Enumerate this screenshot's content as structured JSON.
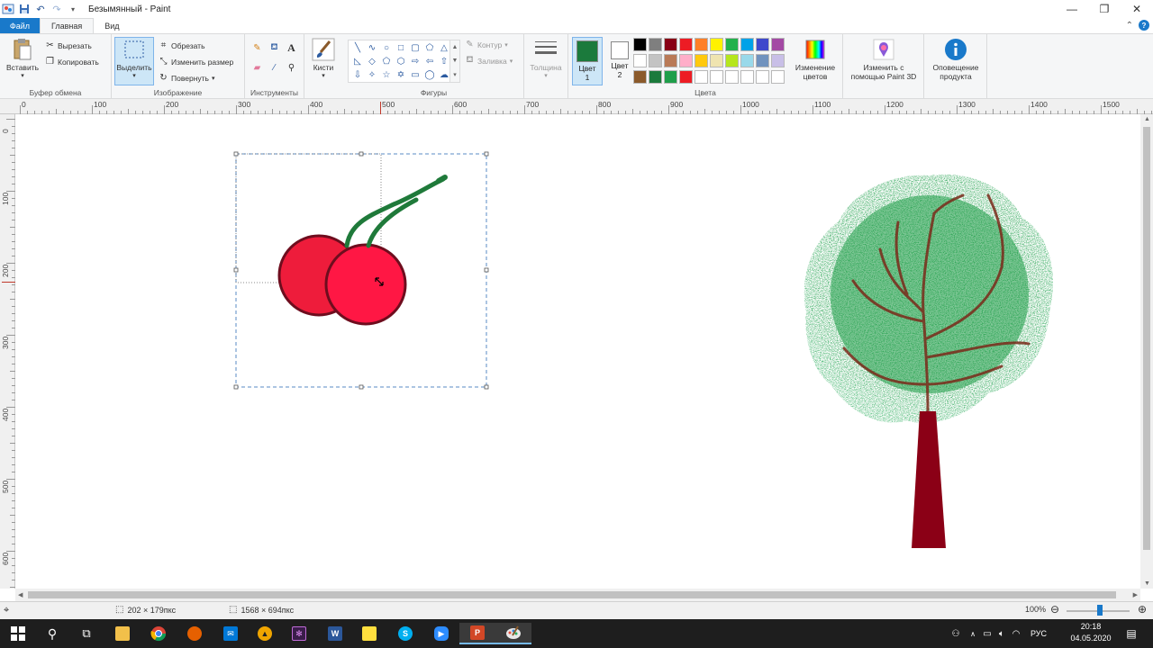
{
  "window": {
    "title": "Безымянный - Paint"
  },
  "tabs": [
    {
      "label": "Файл"
    },
    {
      "label": "Главная"
    },
    {
      "label": "Вид"
    }
  ],
  "ribbon": {
    "clipboard": {
      "group_label": "Буфер обмена",
      "paste": "Вставить",
      "cut": "Вырезать",
      "copy": "Копировать"
    },
    "image": {
      "group_label": "Изображение",
      "select": "Выделить",
      "crop": "Обрезать",
      "resize": "Изменить размер",
      "rotate": "Повернуть"
    },
    "tools": {
      "group_label": "Инструменты"
    },
    "brushes": {
      "label": "Кисти"
    },
    "shapes": {
      "group_label": "Фигуры",
      "outline": "Контур",
      "fill": "Заливка"
    },
    "size": {
      "label": "Толщина"
    },
    "colors": {
      "group_label": "Цвета",
      "color1_label": "Цвет\n1",
      "color1_a": "Цвет",
      "color1_b": "1",
      "color2_a": "Цвет",
      "color2_b": "2",
      "color1": "#1b7a3c",
      "color2": "#ffffff",
      "edit_colors_a": "Изменение",
      "edit_colors_b": "цветов",
      "palette": [
        "#000000",
        "#7f7f7f",
        "#880015",
        "#ed1c24",
        "#ff7f27",
        "#fff200",
        "#22b14c",
        "#00a2e8",
        "#3f48cc",
        "#a349a4",
        "#ffffff",
        "#c3c3c3",
        "#b97a57",
        "#ffaec9",
        "#ffc90e",
        "#efe4b0",
        "#b5e61d",
        "#99d9ea",
        "#7092be",
        "#c8bfe7",
        "#8b5a2b",
        "#1b7a3c",
        "#1e9e4a",
        "#ed1c24",
        "#ffffff",
        "#ffffff",
        "#ffffff",
        "#ffffff",
        "#ffffff",
        "#ffffff"
      ]
    },
    "paint3d": {
      "line1": "Изменить с",
      "line2": "помощью Paint 3D"
    },
    "notify": {
      "line1": "Оповещение",
      "line2": "продукта"
    }
  },
  "ruler": {
    "top": [
      "0",
      "100",
      "200",
      "300",
      "400",
      "500",
      "600",
      "700",
      "800",
      "900",
      "1000",
      "1100",
      "1200",
      "1300",
      "1400",
      "1500"
    ],
    "left": [
      "0",
      "100",
      "200",
      "300",
      "400",
      "500",
      "600"
    ]
  },
  "status": {
    "selection_size": "202 × 179пкс",
    "image_size": "1568 × 694пкс",
    "zoom": "100%"
  },
  "taskbar": {
    "lang": "РУС",
    "time": "20:18",
    "date": "04.05.2020"
  }
}
